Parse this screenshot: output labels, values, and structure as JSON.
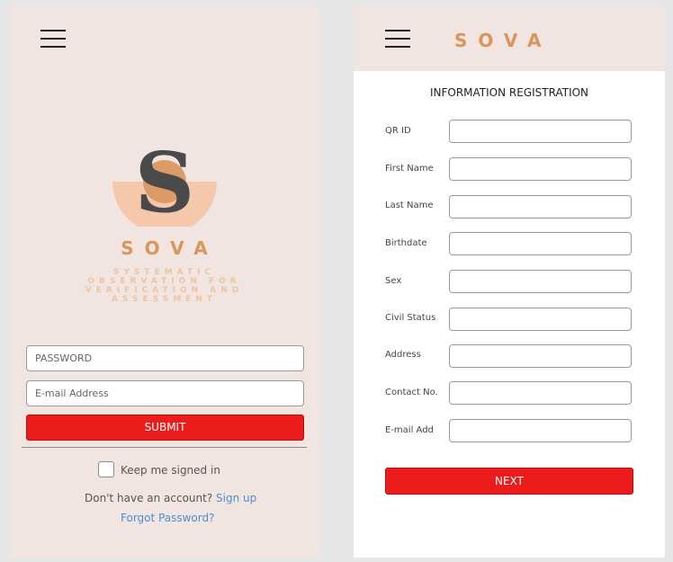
{
  "login": {
    "brand": "SOVA",
    "tagline_lines": [
      "SYSTEMATIC",
      "OBSERVATION FOR",
      "VERIFICATION AND",
      "ASSESSMENT"
    ],
    "password_placeholder": "PASSWORD",
    "email_placeholder": "E-mail Address",
    "submit_label": "SUBMIT",
    "keep_signed_in": "Keep me signed in",
    "no_account_text": "Don't have an account?",
    "signup_link": "Sign up",
    "forgot_password": "Forgot Password?"
  },
  "registration": {
    "brand": "SOVA",
    "title": "INFORMATION REGISTRATION",
    "fields": [
      {
        "label": "QR ID",
        "value": ""
      },
      {
        "label": "First Name",
        "value": ""
      },
      {
        "label": "Last Name",
        "value": ""
      },
      {
        "label": "Birthdate",
        "value": ""
      },
      {
        "label": "Sex",
        "value": ""
      },
      {
        "label": "Civil Status",
        "value": ""
      },
      {
        "label": "Address",
        "value": ""
      },
      {
        "label": "Contact No.",
        "value": ""
      },
      {
        "label": "E-mail Add",
        "value": ""
      }
    ],
    "next_label": "NEXT"
  },
  "icons": {
    "menu": "menu-icon",
    "logo": "sova-logo",
    "checkbox": "checkbox-icon"
  },
  "colors": {
    "accent": "#d9955c",
    "button_red": "#ec1c1c",
    "panel_bg": "#f0e5e1",
    "link": "#4b8fd1"
  }
}
